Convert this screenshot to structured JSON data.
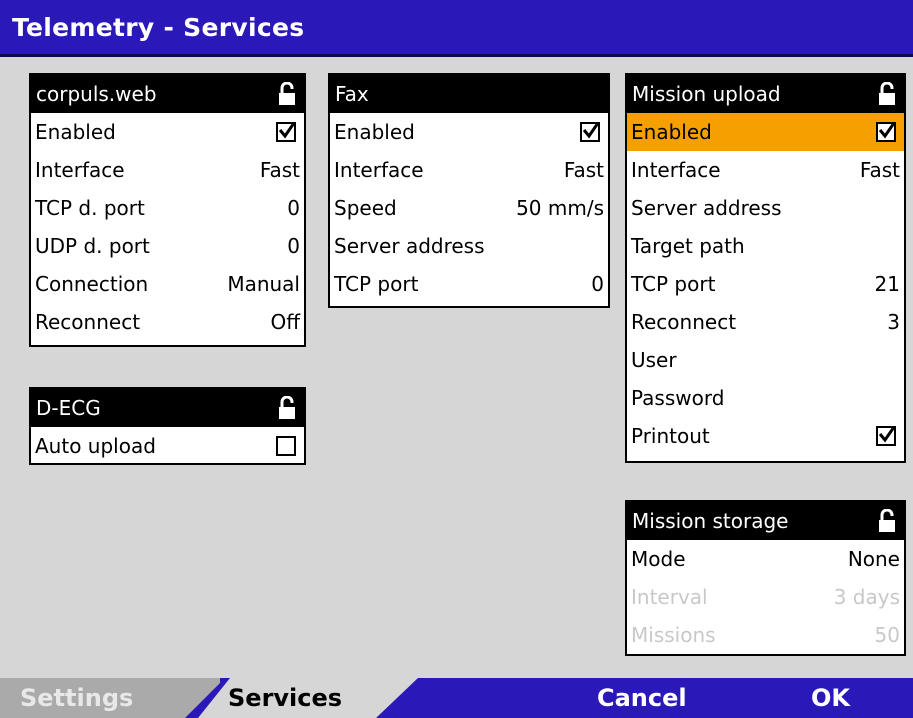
{
  "header": {
    "title": "Telemetry - Services"
  },
  "panels": {
    "corpuls": {
      "title": "corpuls.web",
      "rows": [
        {
          "label": "Enabled",
          "checked": true
        },
        {
          "label": "Interface",
          "value": "Fast"
        },
        {
          "label": "TCP d. port",
          "value": "0"
        },
        {
          "label": "UDP d. port",
          "value": "0"
        },
        {
          "label": "Connection",
          "value": "Manual"
        },
        {
          "label": "Reconnect",
          "value": "Off"
        }
      ]
    },
    "fax": {
      "title": "Fax",
      "rows": [
        {
          "label": "Enabled",
          "checked": true
        },
        {
          "label": "Interface",
          "value": "Fast"
        },
        {
          "label": "Speed",
          "value": "50 mm/s"
        },
        {
          "label": "Server address",
          "value": ""
        },
        {
          "label": "TCP port",
          "value": "0"
        }
      ]
    },
    "mission_upload": {
      "title": "Mission upload",
      "rows": [
        {
          "label": "Enabled",
          "checked": true
        },
        {
          "label": "Interface",
          "value": "Fast"
        },
        {
          "label": "Server address",
          "value": ""
        },
        {
          "label": "Target path",
          "value": ""
        },
        {
          "label": "TCP port",
          "value": "21"
        },
        {
          "label": "Reconnect",
          "value": "3"
        },
        {
          "label": "User",
          "value": ""
        },
        {
          "label": "Password",
          "value": ""
        },
        {
          "label": "Printout",
          "checked": true
        }
      ]
    },
    "decg": {
      "title": "D-ECG",
      "rows": [
        {
          "label": "Auto upload",
          "checked": false
        }
      ]
    },
    "mission_storage": {
      "title": "Mission storage",
      "rows": [
        {
          "label": "Mode",
          "value": "None"
        },
        {
          "label": "Interval",
          "value": "3 days"
        },
        {
          "label": "Missions",
          "value": "50"
        }
      ]
    }
  },
  "footer": {
    "tabs": [
      "Settings",
      "Services"
    ],
    "cancel": "Cancel",
    "ok": "OK"
  },
  "colors": {
    "header_bg": "#2a19b8",
    "highlight": "#f5a000",
    "disabled_text": "#c8c8c8"
  },
  "icons": {
    "lock": "lock-icon",
    "check": "checkbox-checked-icon"
  }
}
